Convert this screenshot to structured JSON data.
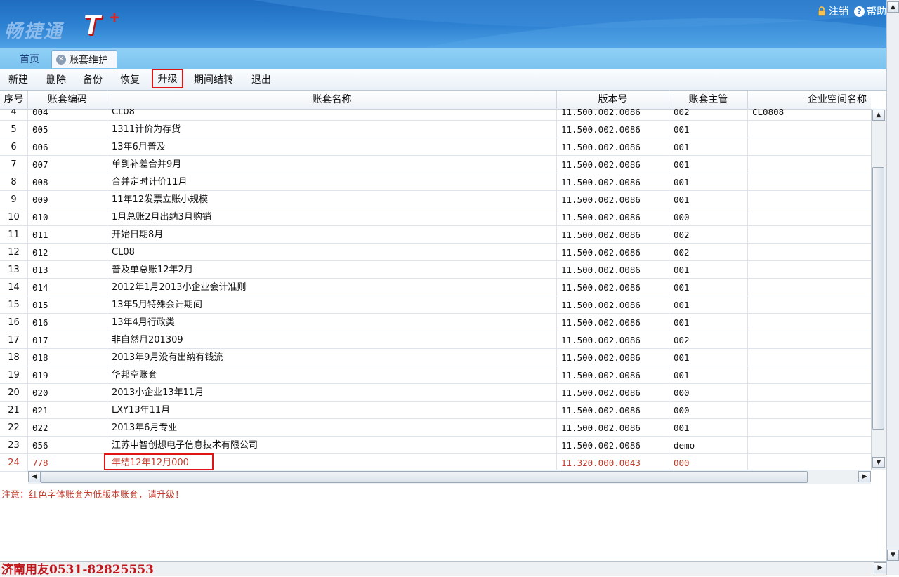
{
  "header": {
    "logo_text": "畅捷通",
    "logo_t": "T",
    "logo_plus": "+",
    "logout_label": "注销",
    "help_label": "帮助"
  },
  "tabs": [
    {
      "label": "首页",
      "active": false
    },
    {
      "label": "账套维护",
      "active": true
    }
  ],
  "toolbar": {
    "buttons": [
      "新建",
      "删除",
      "备份",
      "恢复",
      "升级",
      "期间结转",
      "退出"
    ],
    "highlighted": "升级"
  },
  "table": {
    "columns": [
      "序号",
      "账套编码",
      "账套名称",
      "版本号",
      "账套主管",
      "企业空间名称"
    ],
    "rows": [
      {
        "idx": "4",
        "code": "004",
        "name": "CL08",
        "version": "11.500.002.0086",
        "manager": "002",
        "space": "CL0808"
      },
      {
        "idx": "5",
        "code": "005",
        "name": "1311计价为存货",
        "version": "11.500.002.0086",
        "manager": "001",
        "space": ""
      },
      {
        "idx": "6",
        "code": "006",
        "name": "13年6月普及",
        "version": "11.500.002.0086",
        "manager": "001",
        "space": ""
      },
      {
        "idx": "7",
        "code": "007",
        "name": "单到补差合并9月",
        "version": "11.500.002.0086",
        "manager": "001",
        "space": ""
      },
      {
        "idx": "8",
        "code": "008",
        "name": "合并定时计价11月",
        "version": "11.500.002.0086",
        "manager": "001",
        "space": ""
      },
      {
        "idx": "9",
        "code": "009",
        "name": "11年12发票立账小规模",
        "version": "11.500.002.0086",
        "manager": "001",
        "space": ""
      },
      {
        "idx": "10",
        "code": "010",
        "name": "1月总账2月出纳3月购销",
        "version": "11.500.002.0086",
        "manager": "000",
        "space": ""
      },
      {
        "idx": "11",
        "code": "011",
        "name": "开始日期8月",
        "version": "11.500.002.0086",
        "manager": "002",
        "space": ""
      },
      {
        "idx": "12",
        "code": "012",
        "name": "CL08",
        "version": "11.500.002.0086",
        "manager": "002",
        "space": ""
      },
      {
        "idx": "13",
        "code": "013",
        "name": "普及单总账12年2月",
        "version": "11.500.002.0086",
        "manager": "001",
        "space": ""
      },
      {
        "idx": "14",
        "code": "014",
        "name": "2012年1月2013小企业会计准则",
        "version": "11.500.002.0086",
        "manager": "001",
        "space": ""
      },
      {
        "idx": "15",
        "code": "015",
        "name": "13年5月特殊会计期间",
        "version": "11.500.002.0086",
        "manager": "001",
        "space": ""
      },
      {
        "idx": "16",
        "code": "016",
        "name": "13年4月行政类",
        "version": "11.500.002.0086",
        "manager": "001",
        "space": ""
      },
      {
        "idx": "17",
        "code": "017",
        "name": "非自然月201309",
        "version": "11.500.002.0086",
        "manager": "002",
        "space": ""
      },
      {
        "idx": "18",
        "code": "018",
        "name": "2013年9月没有出纳有钱流",
        "version": "11.500.002.0086",
        "manager": "001",
        "space": ""
      },
      {
        "idx": "19",
        "code": "019",
        "name": "华邦空账套",
        "version": "11.500.002.0086",
        "manager": "001",
        "space": ""
      },
      {
        "idx": "20",
        "code": "020",
        "name": "2013小企业13年11月",
        "version": "11.500.002.0086",
        "manager": "000",
        "space": ""
      },
      {
        "idx": "21",
        "code": "021",
        "name": "LXY13年11月",
        "version": "11.500.002.0086",
        "manager": "000",
        "space": ""
      },
      {
        "idx": "22",
        "code": "022",
        "name": "2013年6月专业",
        "version": "11.500.002.0086",
        "manager": "001",
        "space": ""
      },
      {
        "idx": "23",
        "code": "056",
        "name": "江苏中智创想电子信息技术有限公司",
        "version": "11.500.002.0086",
        "manager": "demo",
        "space": ""
      },
      {
        "idx": "24",
        "code": "778",
        "name": "年结12年12月000",
        "version": "11.320.000.0043",
        "manager": "000",
        "space": "",
        "low_version": true
      }
    ]
  },
  "notice": "注意：红色字体账套为低版本账套，请升级！",
  "watermark": "济南用友0531-82825553",
  "colors": {
    "low_version_text": "#c0392b",
    "highlight_border": "#e01414",
    "header_blue": "#2e82d2"
  }
}
